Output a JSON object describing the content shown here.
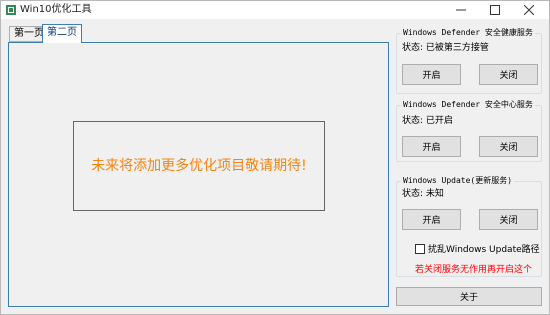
{
  "window": {
    "title": "Win10优化工具"
  },
  "tabs": [
    {
      "label": "第一页"
    },
    {
      "label": "第二页"
    }
  ],
  "tab_page": {
    "notice": "未来将添加更多优化项目敬请期待!"
  },
  "defender_health": {
    "title": "Windows Defender 安全健康服务",
    "status": "状态: 已被第三方接管",
    "enable_label": "开启",
    "disable_label": "关闭"
  },
  "defender_center": {
    "title": "Windows Defender 安全中心服务",
    "status": "状态: 已开启",
    "enable_label": "开启",
    "disable_label": "关闭"
  },
  "windows_update": {
    "title": "Windows Update(更新服务)",
    "status": "状态: 未知",
    "enable_label": "开启",
    "disable_label": "关闭",
    "checkbox_label": "扰乱Windows Update路径",
    "checkbox_checked": false,
    "warning": "若关闭服务无作用再开启这个"
  },
  "about_label": "关于",
  "colors": {
    "notice": "#f58512",
    "warning": "#ff0000",
    "tab_active_border": "#3c7fb1"
  },
  "icons": {
    "app": "app-icon",
    "minimize": "minimize-icon",
    "maximize": "maximize-icon",
    "close": "close-icon"
  }
}
